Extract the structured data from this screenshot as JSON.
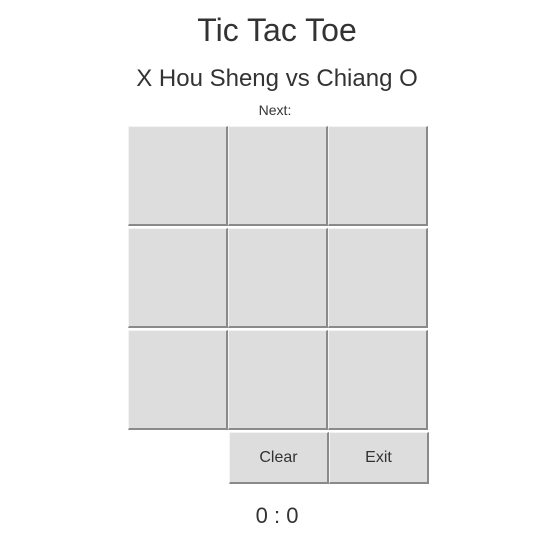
{
  "game": {
    "title": "Tic Tac Toe",
    "player_x_label": "X Hou Sheng",
    "versus": "vs",
    "player_o_label": "Chiang O",
    "next_label": "Next:",
    "next_player": ""
  },
  "board": {
    "cells": [
      "",
      "",
      "",
      "",
      "",
      "",
      "",
      "",
      ""
    ]
  },
  "controls": {
    "clear_label": "Clear",
    "exit_label": "Exit"
  },
  "score": {
    "x": "0",
    "separator": ":",
    "o": "0"
  },
  "colors": {
    "cell_background": "#dddddd",
    "text": "#333333",
    "page_background": "#ffffff"
  }
}
